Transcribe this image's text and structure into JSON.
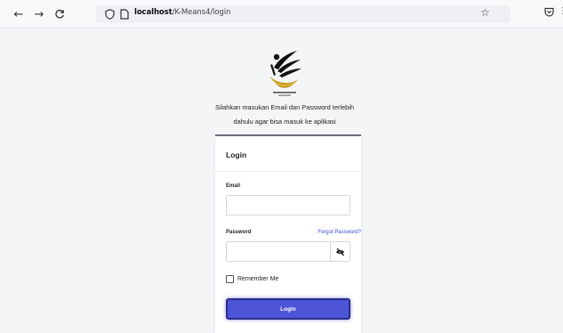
{
  "browser": {
    "back_icon": "←",
    "forward_icon": "→",
    "reload_icon": "C",
    "url_host": "localhost",
    "url_path": "/K-Means4/login",
    "bookmark_icon": "☆",
    "menu_icon": "⋮"
  },
  "page": {
    "intro_line1": "Silahkan masukan Email dan Password terlebih",
    "intro_line2": "dahulu agar bisa masuk ke aplikasi"
  },
  "login_card": {
    "title": "Login",
    "email_label": "Email",
    "email_value": "",
    "password_label": "Password",
    "password_value": "",
    "forgot_label": "Forgot Password?",
    "remember_label": "Remember Me",
    "remember_checked": false,
    "submit_label": "Login"
  },
  "colors": {
    "accent": "#4d55d6",
    "link": "#3d4ad2",
    "card_border": "#6c6c78"
  }
}
